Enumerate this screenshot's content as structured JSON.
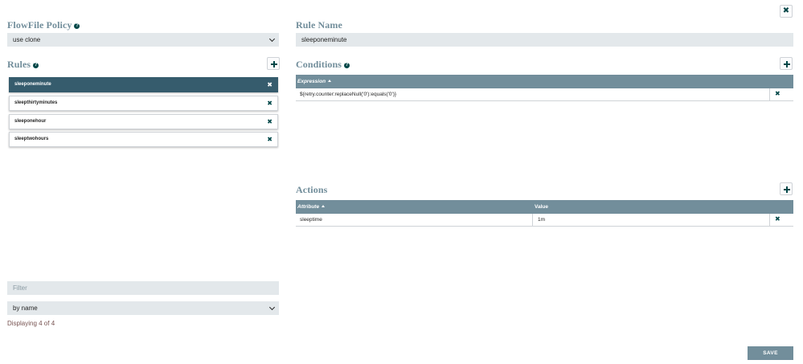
{
  "flowfile_policy": {
    "heading": "FlowFile Policy",
    "value": "use clone"
  },
  "rules": {
    "heading": "Rules",
    "items": [
      {
        "label": "sleeponeminute",
        "selected": true
      },
      {
        "label": "sleepthirtyminutes",
        "selected": false
      },
      {
        "label": "sleeponehour",
        "selected": false
      },
      {
        "label": "sleeptwohours",
        "selected": false
      }
    ]
  },
  "filter": {
    "placeholder": "Filter",
    "sort_by": "by name",
    "status": "Displaying 4 of 4"
  },
  "rule_name": {
    "heading": "Rule Name",
    "value": "sleeponeminute"
  },
  "conditions": {
    "heading": "Conditions",
    "column_expression": "Expression",
    "rows": [
      {
        "expression": "${retry.counter:replaceNull('0'):equals('0')}"
      }
    ]
  },
  "actions": {
    "heading": "Actions",
    "column_attribute": "Attribute",
    "column_value": "Value",
    "rows": [
      {
        "attribute": "sleeptime",
        "value": "1m"
      }
    ]
  },
  "buttons": {
    "save": "SAVE",
    "close": "✖",
    "add": "+",
    "remove": "✖"
  },
  "colors": {
    "accent_dark": "#004849",
    "header_gray_blue": "#728e9b",
    "selected_rule": "#365c6d",
    "input_bg": "#e3e8eb",
    "status_text": "#775351"
  },
  "icons": {
    "help": "question-circle-icon",
    "add": "plus-icon",
    "remove": "times-icon",
    "dropdown": "chevron-down-icon",
    "sort": "caret-up-icon"
  }
}
